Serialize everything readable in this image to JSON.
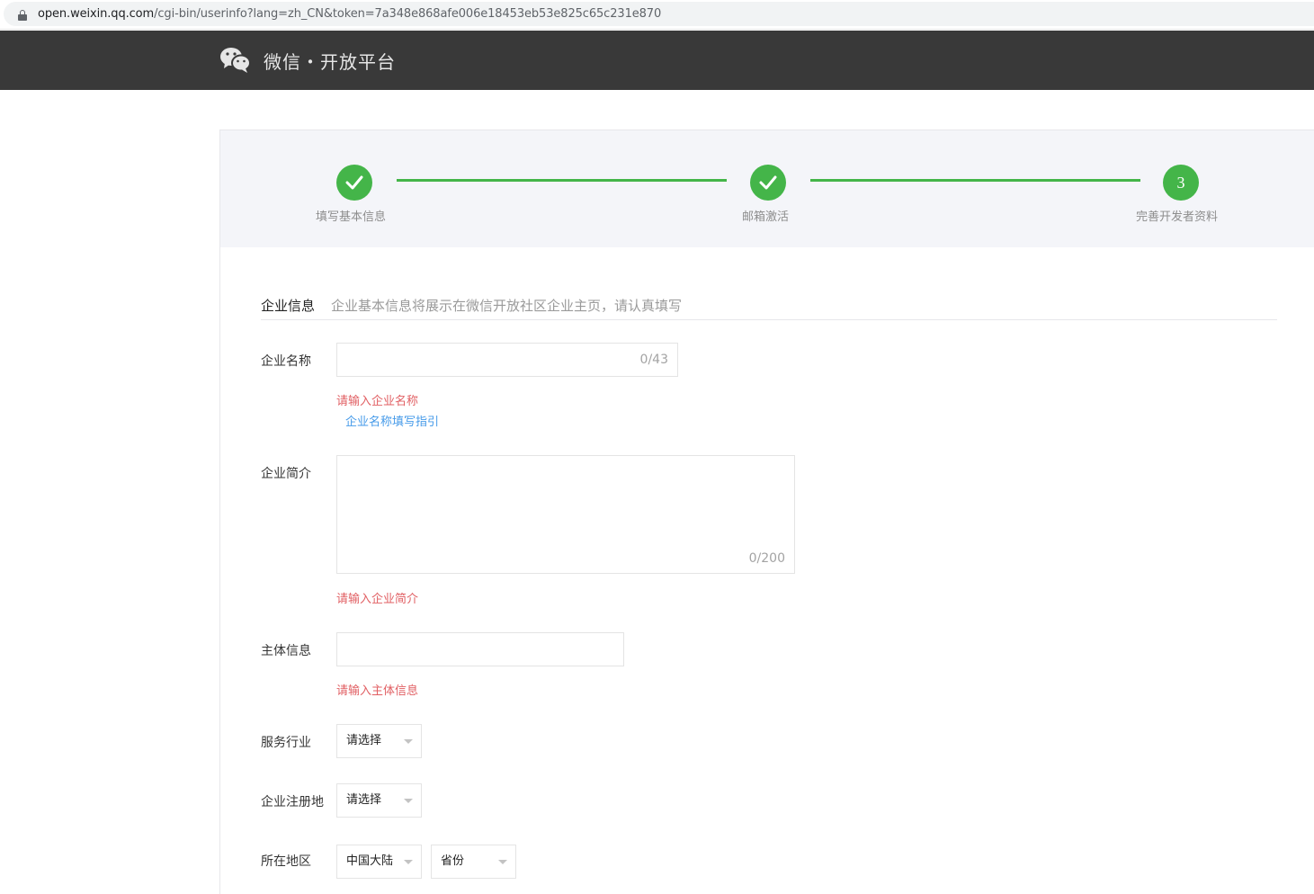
{
  "browser": {
    "url_host": "open.weixin.qq.com",
    "url_path": "/cgi-bin/userinfo?lang=zh_CN&token=7a348e868afe006e18453eb53e825c65c231e870"
  },
  "header": {
    "brand": "微信・开放平台",
    "logo_icon": "wechat-logo-icon"
  },
  "steps": [
    {
      "label": "填写基本信息",
      "state": "done",
      "icon": "check-icon"
    },
    {
      "label": "邮箱激活",
      "state": "done",
      "icon": "check-icon"
    },
    {
      "label": "完善开发者资料",
      "state": "current",
      "number": "3"
    }
  ],
  "form": {
    "section_title": "企业信息",
    "section_desc": "企业基本信息将展示在微信开放社区企业主页，请认真填写",
    "company_name": {
      "label": "企业名称",
      "value": "",
      "counter": "0/43",
      "error": "请输入企业名称",
      "guide_link": "企业名称填写指引"
    },
    "company_intro": {
      "label": "企业简介",
      "value": "",
      "counter": "0/200",
      "error": "请输入企业简介"
    },
    "entity_info": {
      "label": "主体信息",
      "value": "",
      "error": "请输入主体信息"
    },
    "industry": {
      "label": "服务行业",
      "selected": "请选择"
    },
    "reg_place": {
      "label": "企业注册地",
      "selected": "请选择"
    },
    "region": {
      "label": "所在地区",
      "country": "中国大陆",
      "province": "省份"
    }
  },
  "colors": {
    "header_bg": "#393939",
    "accent_green": "#44b549",
    "error_red": "#e15f63",
    "link_blue": "#459ae9",
    "steps_bg": "#f4f5f9"
  }
}
